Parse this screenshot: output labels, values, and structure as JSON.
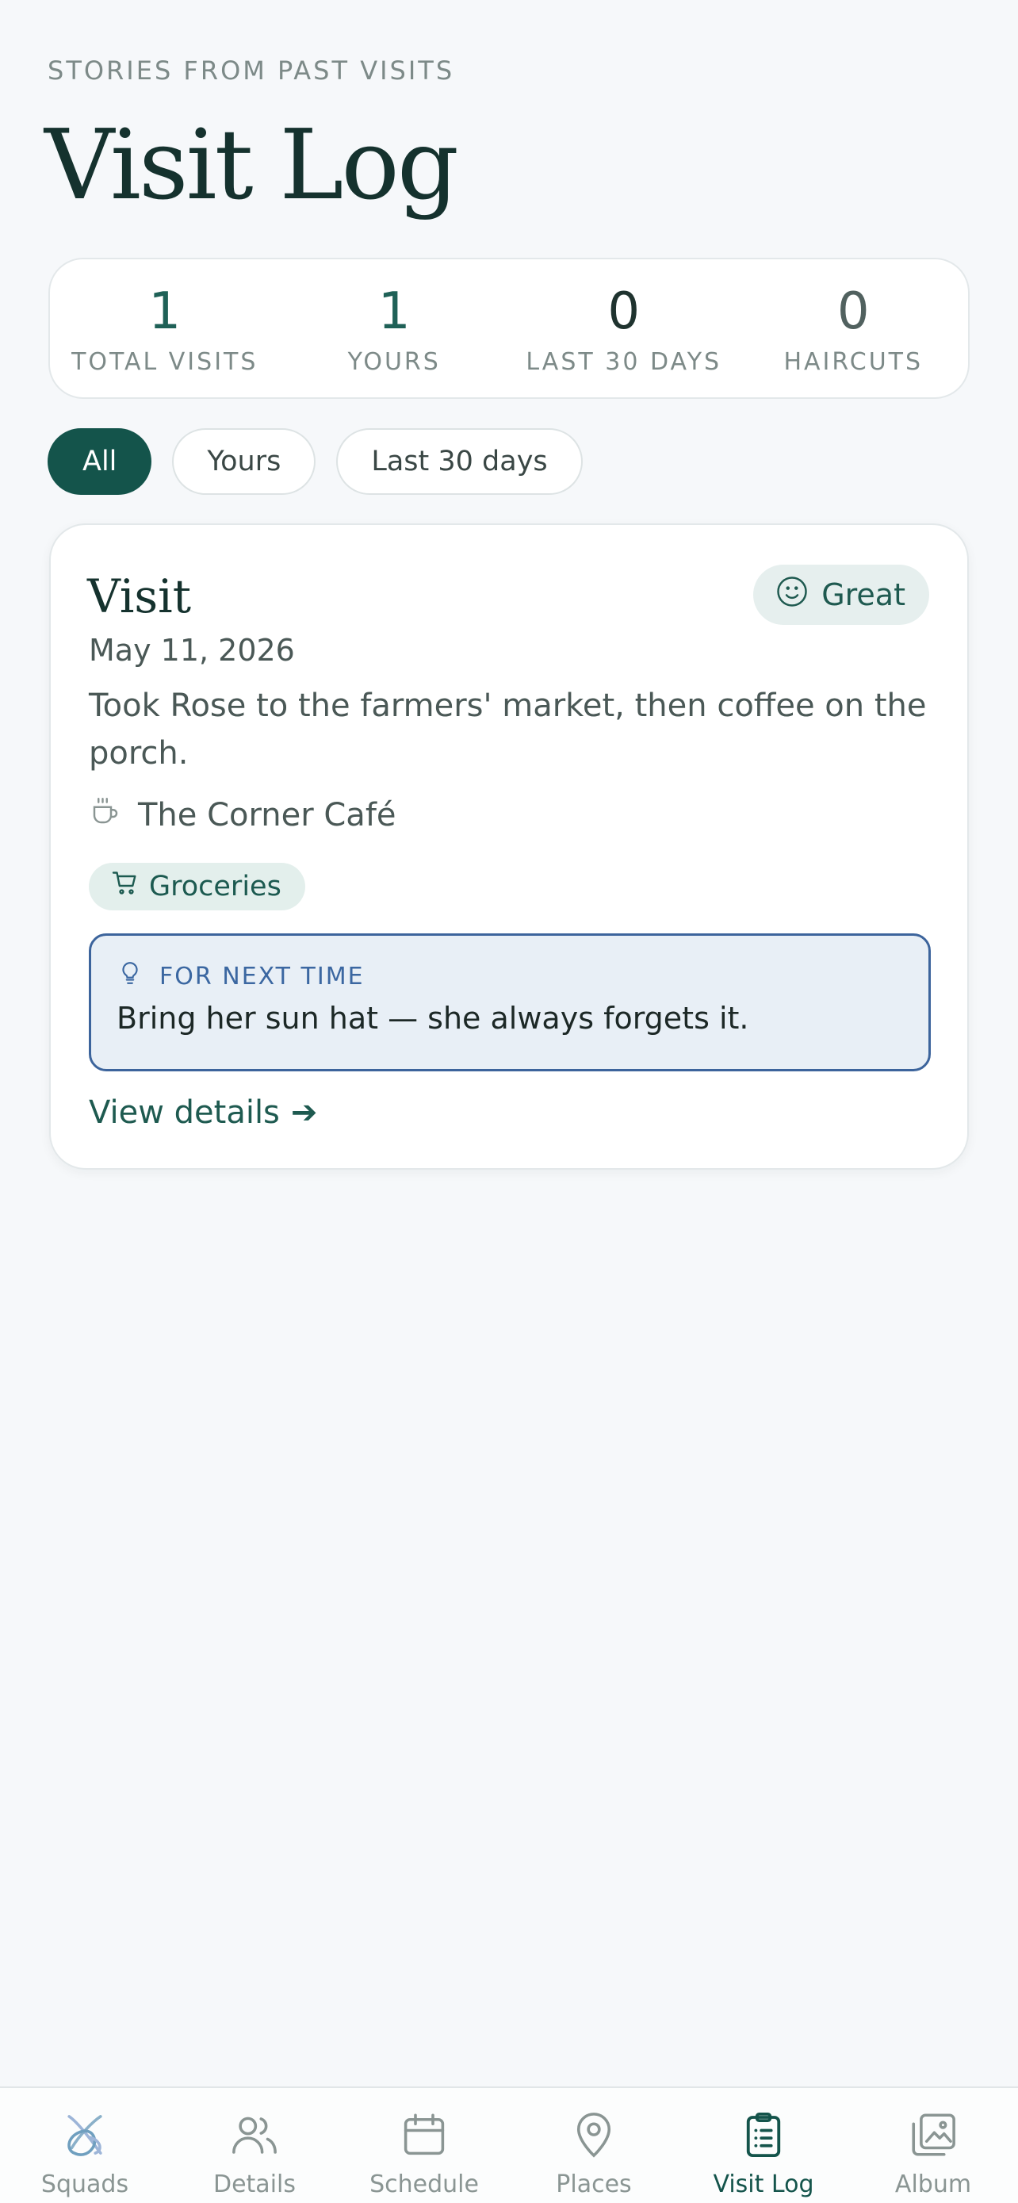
{
  "header": {
    "eyebrow": "STORIES FROM PAST VISITS",
    "title": "Visit Log"
  },
  "stats": [
    {
      "value": "1",
      "label": "TOTAL VISITS"
    },
    {
      "value": "1",
      "label": "YOURS"
    },
    {
      "value": "0",
      "label": "LAST 30 DAYS"
    },
    {
      "value": "0",
      "label": "HAIRCUTS"
    }
  ],
  "filters": {
    "all": "All",
    "yours": "Yours",
    "last30": "Last 30 days",
    "selected": "All"
  },
  "visit": {
    "title": "Visit",
    "mood": "Great",
    "date": "May 11, 2026",
    "note": "Took Rose to the farmers' market, then coffee on the porch.",
    "place": "The Corner Café",
    "tag": "Groceries",
    "tip_heading": "FOR NEXT TIME",
    "tip_text": "Bring her sun hat — she always forgets it.",
    "link": "View details",
    "link_arrow": "➔"
  },
  "tabs": [
    {
      "label": "Squads",
      "icon": "squads-logo-icon"
    },
    {
      "label": "Details",
      "icon": "people-icon"
    },
    {
      "label": "Schedule",
      "icon": "calendar-icon"
    },
    {
      "label": "Places",
      "icon": "map-pin-icon"
    },
    {
      "label": "Visit Log",
      "icon": "clipboard-icon",
      "active": true
    },
    {
      "label": "Album",
      "icon": "photo-album-icon"
    }
  ],
  "colors": {
    "accent": "#14544b",
    "background": "#f6f8fa",
    "tip_border": "#3c649c",
    "tip_bg": "#e8eff6"
  }
}
